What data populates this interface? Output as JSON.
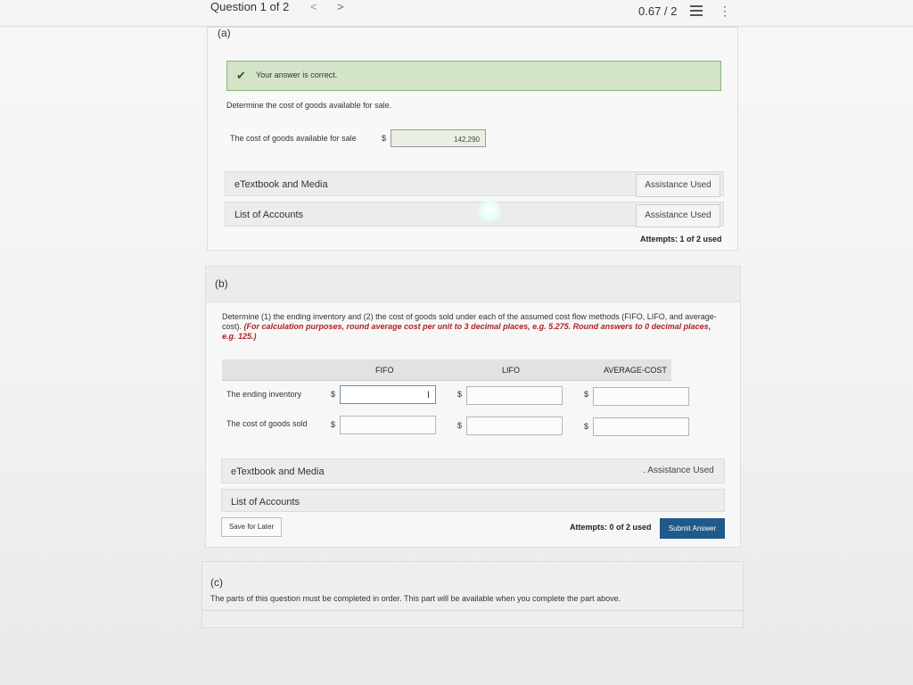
{
  "header": {
    "question_counter": "Question 1 of 2",
    "prev": "<",
    "next": ">",
    "score": "0.67 / 2",
    "kebab": "⋮"
  },
  "part_a": {
    "letter": "(a)",
    "feedback": "Your answer is correct.",
    "prompt": "Determine the cost of goods available for sale.",
    "row_label": "The cost of goods available for sale",
    "currency": "$",
    "answer": "142,290",
    "media_label": "eTextbook and Media",
    "media_assist": "Assistance Used",
    "accounts_label": "List of Accounts",
    "accounts_assist": "Assistance Used",
    "attempts": "Attempts: 1 of 2 used"
  },
  "part_b": {
    "letter": "(b)",
    "instruction_main": "Determine (1) the ending inventory and (2) the cost of goods sold under each of the assumed cost flow methods (FIFO, LIFO, and average-cost).",
    "instruction_note": "(For calculation purposes, round average cost per unit to 3 decimal places, e.g. 5.275. Round answers to 0 decimal places, e.g. 125.)",
    "columns": [
      "FIFO",
      "LIFO",
      "AVERAGE-COST"
    ],
    "rows": [
      {
        "label": "The ending inventory"
      },
      {
        "label": "The cost of goods sold"
      }
    ],
    "currency": "$",
    "media_label": "eTextbook and Media",
    "media_assist": ". Assistance Used",
    "accounts_label": "List of Accounts",
    "save_label": "Save for Later",
    "attempts": "Attempts: 0 of 2 used",
    "submit_label": "Submit Answer"
  },
  "part_c": {
    "letter": "(c)",
    "message": "The parts of this question must be completed in order. This part will be available when you complete the part above."
  },
  "colors": {
    "success_bg": "#d4e4c8",
    "submit_bg": "#1f5a8a",
    "note_red": "#b02222"
  }
}
